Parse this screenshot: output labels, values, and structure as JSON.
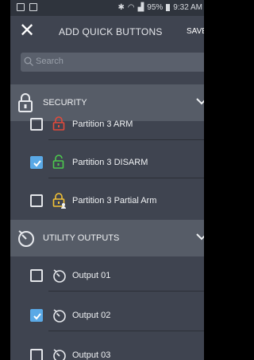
{
  "status_bar": {
    "battery": "95%",
    "time": "9:32 AM"
  },
  "header": {
    "title": "ADD QUICK BUTTONS",
    "save_label": "SAVE"
  },
  "search": {
    "placeholder": "Search"
  },
  "sections": [
    {
      "label": "SECURITY",
      "items": [
        {
          "label": "Partition 3 ARM",
          "checked": false,
          "icon": "lock-closed-red-icon"
        },
        {
          "label": "Partition 3 DISARM",
          "checked": true,
          "icon": "lock-open-green-icon"
        },
        {
          "label": "Partition 3 Partial Arm",
          "checked": false,
          "icon": "lock-partial-yellow-icon"
        }
      ]
    },
    {
      "label": "UTILITY OUTPUTS",
      "items": [
        {
          "label": "Output 01",
          "checked": false,
          "icon": "stopwatch-icon"
        },
        {
          "label": "Output 02",
          "checked": true,
          "icon": "stopwatch-icon"
        },
        {
          "label": "Output 03",
          "checked": false,
          "icon": "stopwatch-icon"
        }
      ]
    }
  ],
  "colors": {
    "background": "#3f4450",
    "section": "#565c67",
    "checked": "#5aa9e6",
    "lock_red": "#e24a3b",
    "lock_green": "#4cc94d",
    "lock_yellow": "#f3c235"
  }
}
